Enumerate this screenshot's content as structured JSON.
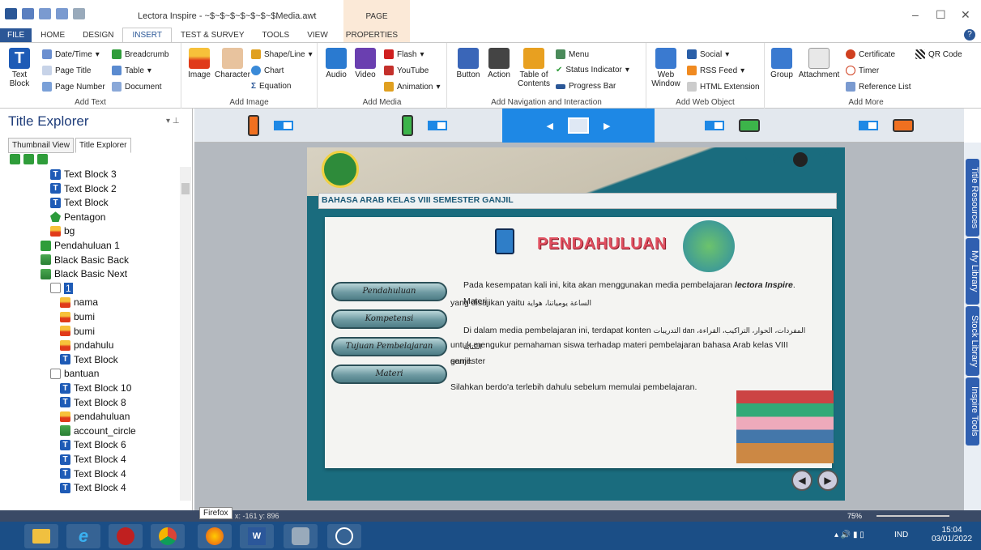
{
  "window": {
    "title": "Lectora Inspire - ~$~$~$~$~$~$~$Media.awt",
    "context_group": "PAGE"
  },
  "tabs": [
    "FILE",
    "HOME",
    "DESIGN",
    "INSERT",
    "TEST & SURVEY",
    "TOOLS",
    "VIEW",
    "PROPERTIES"
  ],
  "active_tab": "INSERT",
  "ribbon": {
    "text": {
      "big": "Text Block",
      "items": [
        "Date/Time",
        "Page Title",
        "Page Number",
        "Breadcrumb",
        "Table",
        "Document"
      ],
      "label": "Add Text"
    },
    "image": {
      "items": [
        "Image",
        "Character",
        "Shape/Line",
        "Chart",
        "Equation"
      ],
      "label": "Add Image"
    },
    "media": {
      "items": [
        "Audio",
        "Video",
        "Flash",
        "YouTube",
        "Animation"
      ],
      "label": "Add Media"
    },
    "nav": {
      "items": [
        "Button",
        "Action",
        "Table of Contents",
        "Menu",
        "Status Indicator",
        "Progress Bar"
      ],
      "label": "Add Navigation and Interaction"
    },
    "web": {
      "items": [
        "Web Window",
        "Social",
        "RSS Feed",
        "HTML Extension"
      ],
      "label": "Add Web Object"
    },
    "more": {
      "items": [
        "Group",
        "Attachment",
        "Certificate",
        "Timer",
        "Reference List",
        "QR Code"
      ],
      "label": "Add More"
    }
  },
  "left_panel": {
    "title": "Title Explorer",
    "tabs": [
      "Thumbnail View",
      "Title Explorer"
    ],
    "tree": [
      {
        "label": "Text Block 3",
        "icon": "T"
      },
      {
        "label": "Text Block 2",
        "icon": "T"
      },
      {
        "label": "Text Block",
        "icon": "T"
      },
      {
        "label": "Pentagon",
        "icon": "pent"
      },
      {
        "label": "bg",
        "icon": "img"
      },
      {
        "label": "Pendahuluan 1",
        "icon": "grn"
      },
      {
        "label": "Black Basic Back",
        "icon": "nav"
      },
      {
        "label": "Black Basic Next",
        "icon": "nav"
      },
      {
        "label": "1",
        "icon": "doc"
      },
      {
        "label": "nama",
        "icon": "img"
      },
      {
        "label": "bumi",
        "icon": "img"
      },
      {
        "label": "bumi",
        "icon": "img"
      },
      {
        "label": "pndahulu",
        "icon": "img"
      },
      {
        "label": "Text Block",
        "icon": "T"
      },
      {
        "label": "bantuan",
        "icon": "doc"
      },
      {
        "label": "Text Block 10",
        "icon": "T"
      },
      {
        "label": "Text Block 8",
        "icon": "T"
      },
      {
        "label": "pendahuluan",
        "icon": "img"
      },
      {
        "label": "account_circle",
        "icon": "nav"
      },
      {
        "label": "Text Block 6",
        "icon": "T"
      },
      {
        "label": "Text Block 4",
        "icon": "T"
      },
      {
        "label": "Text Block 4",
        "icon": "T"
      },
      {
        "label": "Text Block 4",
        "icon": "T"
      }
    ]
  },
  "slide": {
    "header": "BAHASA ARAB KELAS VIII SEMESTER GANJIL",
    "heading": "PENDAHULUAN",
    "nav_icons": [
      "?",
      "X"
    ],
    "buttons": [
      "Pendahuluan",
      "Kompetensi",
      "Tujuan Pembelajaran",
      "Materi"
    ],
    "p1_a": "Pada kesempatan kali ini, kita akan menggunakan media pembelajaran",
    "p1_b": "lectora Inspire",
    "p1_c": ". Materi",
    "p1_d": "yang disajikan yaitu",
    "p1_arabic": "الساعة يومياتنا، هواية",
    "p2_a": "Di dalam media pembelajaran ini, terdapat konten",
    "p2_arabic": "التدريبات dan المفردات، الحوار، التراكيب، القراءة، الكتابة",
    "p2_b": "untuk mengukur pemahaman siswa terhadap materi pembelajaran bahasa Arab kelas VIII semester",
    "p2_c": "ganjil.",
    "p3": "Silahkan berdo'a terlebih dahulu sebelum memulai pembelajaran."
  },
  "side_tabs": [
    "Title Resources",
    "My Library",
    "Stock Library",
    "Inspire Tools"
  ],
  "status": {
    "tooltip": "Firefox",
    "coords": "x: -161  y: 896",
    "zoom": "75%"
  },
  "tray": {
    "lang": "IND",
    "time": "15:04",
    "date": "03/01/2022"
  }
}
